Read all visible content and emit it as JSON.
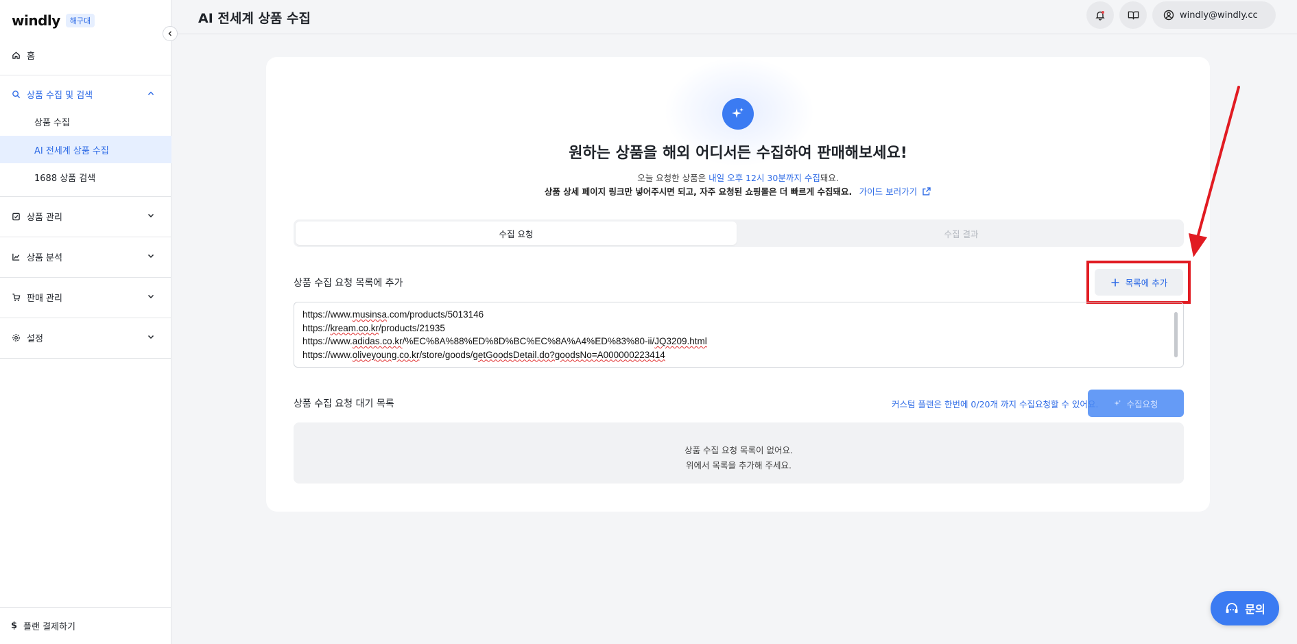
{
  "brand": {
    "logo": "windly",
    "badge": "해구대"
  },
  "sidebar": {
    "home": "홈",
    "group_collect": "상품 수집 및 검색",
    "sub_items": [
      "상품 수집",
      "AI 전세계 상품 수집",
      "1688 상품 검색"
    ],
    "manage": "상품 관리",
    "analysis": "상품 분석",
    "sales": "판매 관리",
    "settings": "설정",
    "plan": "플랜 결제하기"
  },
  "header": {
    "title": "AI 전세계 상품 수집",
    "user": "windly@windly.cc"
  },
  "main": {
    "headline": "원하는 상품을 해외 어디서든 수집하여 판매해보세요!",
    "sub1_prefix": "오늘 요청한 상품은 ",
    "sub1_highlight": "내일 오후 12시 30분까지 수집",
    "sub1_suffix": "돼요.",
    "sub2": "상품 상세 페이지 링크만 넣어주시면 되고, 자주 요청된 쇼핑몰은 더 빠르게 수집돼요.",
    "guide_link": "가이드 보러가기",
    "tabs": [
      "수집 요청",
      "수집 결과"
    ],
    "add_section_title": "상품 수집 요청 목록에 추가",
    "add_button": "목록에 추가",
    "urls": [
      {
        "host": "https://www.",
        "sq": "musinsa",
        "rest": ".com/products/5013146"
      },
      {
        "host": "https://",
        "sq": "kream.co.kr",
        "rest": "/products/21935"
      },
      {
        "host": "https://www.",
        "sq": "adidas.co.kr",
        "rest": "/%EC%8A%88%ED%8D%BC%EC%8A%A4%ED%83%80-ii/",
        "sq2": "JQ3209.html"
      },
      {
        "host": "https://www.",
        "sq": "oliveyoung.co.kr",
        "rest": "/store/goods/",
        "sq2": "getGoodsDetail.do?goodsNo=A000000223414"
      }
    ],
    "queue_title": "상품 수집 요청 대기 목록",
    "limit_text": "커스텀 플랜은 한번에 0/20개 까지 수집요청할 수 있어요.",
    "request_button": "수집요청",
    "empty_line1": "상품 수집 요청 목록이 없어요.",
    "empty_line2": "위에서 목록을 추가해 주세요."
  },
  "chat": {
    "label": "문의"
  },
  "colors": {
    "accent": "#2e6be6",
    "annotation": "#e11b22"
  }
}
